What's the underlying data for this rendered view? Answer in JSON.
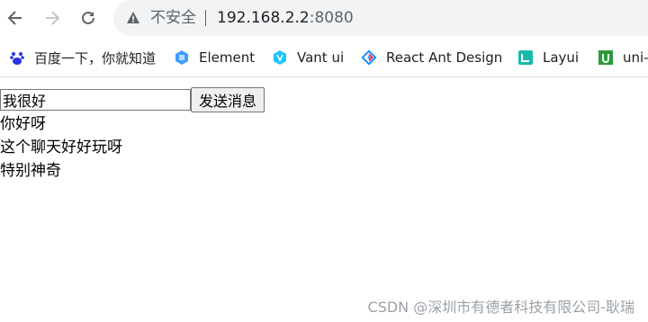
{
  "browser": {
    "security_text": "不安全",
    "url_host": "192.168.2.2",
    "url_port": ":8080",
    "bookmarks": [
      {
        "label": "百度一下，你就知道",
        "icon": "baidu-icon",
        "color": "#2932e1"
      },
      {
        "label": "Element",
        "icon": "element-icon",
        "color": "#409eff"
      },
      {
        "label": "Vant ui",
        "icon": "vant-icon",
        "color": "#1ac6ff"
      },
      {
        "label": "React Ant Design",
        "icon": "antd-icon",
        "color": "#1890ff"
      },
      {
        "label": "Layui",
        "icon": "layui-icon",
        "color": "#16baaa"
      },
      {
        "label": "uni-",
        "icon": "uniapp-icon",
        "color": "#2b9939"
      }
    ]
  },
  "chat": {
    "input_value": "我很好",
    "send_label": "发送消息",
    "messages": [
      "你好呀",
      "这个聊天好好玩呀",
      "特别神奇"
    ]
  },
  "watermark": "CSDN @深圳市有德者科技有限公司-耿瑞"
}
